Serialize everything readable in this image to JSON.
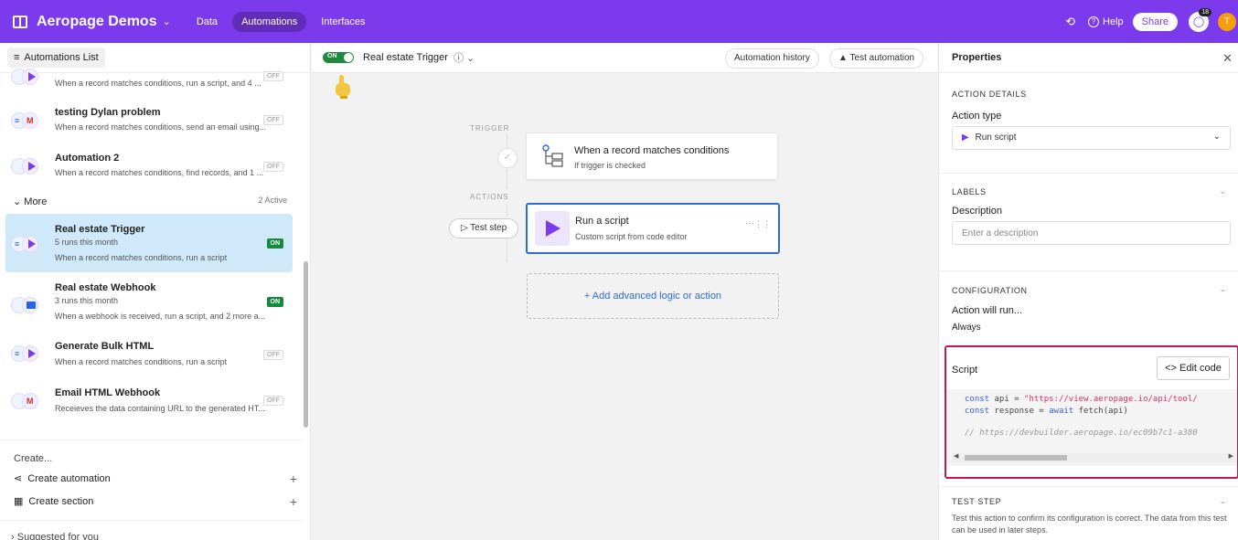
{
  "app": {
    "name": "Aeropage Demos",
    "nav": [
      "Data",
      "Automations",
      "Interfaces"
    ],
    "active_nav": "Automations",
    "help_label": "Help",
    "share_label": "Share",
    "notif_count": "18",
    "avatar_initial": "T",
    "accent": "#7c3aed"
  },
  "sidebar": {
    "header": "Automations List",
    "partial_item_sub": "When a record matches conditions, run a script, and 4 ...",
    "items": [
      {
        "title": "testing Dylan problem",
        "sub": "When a record matches conditions, send an email using...",
        "status": "OFF"
      },
      {
        "title": "Automation 2",
        "sub": "When a record matches conditions, find records, and 1 ...",
        "status": "OFF"
      }
    ],
    "more_label": "More",
    "more_active": "2 Active",
    "more_items": [
      {
        "title": "Real estate Trigger",
        "runs": "5 runs this month",
        "sub": "When a record matches conditions, run a script",
        "status": "ON"
      },
      {
        "title": "Real estate Webhook",
        "runs": "3 runs this month",
        "sub": "When a webhook is received, run a script, and 2 more a...",
        "status": "ON"
      },
      {
        "title": "Generate Bulk HTML",
        "sub": "When a record matches conditions, run a script",
        "status": "OFF"
      },
      {
        "title": "Email HTML Webhook",
        "sub": "Receieves the data containing URL to the generated HT...",
        "status": "OFF"
      }
    ],
    "create_label": "Create...",
    "create_automation": "Create automation",
    "create_section": "Create section",
    "suggested": "Suggested for you"
  },
  "canvas": {
    "toggle_label": "ON",
    "trigger_name": "Real estate Trigger",
    "history_btn": "Automation history",
    "test_btn": "Test automation",
    "trigger_section": "TRIGGER",
    "actions_section": "ACTIONS",
    "trigger_card": {
      "title": "When a record matches conditions",
      "sub": "If trigger is checked"
    },
    "test_step": "Test step",
    "action_card": {
      "title": "Run a script",
      "sub": "Custom script from code editor"
    },
    "add_label": "+ Add advanced logic or action"
  },
  "props": {
    "title": "Properties",
    "action_details": "ACTION DETAILS",
    "action_type_label": "Action type",
    "action_type_value": "Run script",
    "labels_section": "LABELS",
    "description_label": "Description",
    "description_placeholder": "Enter a description",
    "configuration_section": "CONFIGURATION",
    "action_will_run": "Action will run...",
    "always": "Always",
    "script_label": "Script",
    "edit_code": "<> Edit code",
    "code": {
      "l1_kw": "const",
      "l1_var": " api = ",
      "l1_str": "\"https://view.aeropage.io/api/tool/",
      "l2_kw": "const",
      "l2_var": " response = ",
      "l2_kw2": "await",
      "l2_fn": " fetch(api)",
      "l4_cm": "// https://devbuilder.aeropage.io/ec09b7c1-a380"
    },
    "test_step_section": "TEST STEP",
    "test_step_text": "Test this action to confirm its configuration is correct. The data from this test can be used in later steps."
  }
}
